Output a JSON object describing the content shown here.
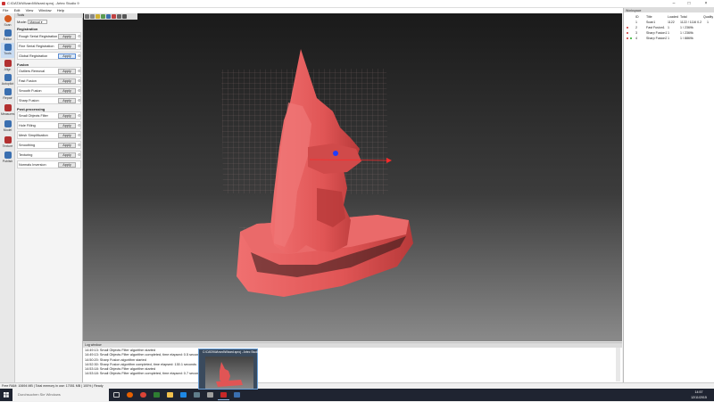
{
  "window": {
    "title": "C:\\DATA\\Wizard\\Wizard.sproj - Artec Studio 9"
  },
  "menu": [
    "File",
    "Edit",
    "View",
    "Window",
    "Help"
  ],
  "tools": [
    {
      "label": "Scan",
      "icon": "scan-icon",
      "color": "#d45a20"
    },
    {
      "label": "Editor",
      "icon": "editor-icon",
      "color": "#3a6fb0"
    },
    {
      "label": "Tools",
      "icon": "tools-icon",
      "color": "#3a6fb0"
    },
    {
      "label": "Align",
      "icon": "align-icon",
      "color": "#b23030"
    },
    {
      "label": "Autopilot",
      "icon": "autopilot-icon",
      "color": "#3a6fb0"
    },
    {
      "label": "Repair",
      "icon": "repair-icon",
      "color": "#3a6fb0"
    },
    {
      "label": "Measures",
      "icon": "measures-icon",
      "color": "#b23030"
    },
    {
      "label": "Model",
      "icon": "model-icon",
      "color": "#3a6fb0"
    },
    {
      "label": "Texture",
      "icon": "texture-icon",
      "color": "#b23030"
    },
    {
      "label": "Publish",
      "icon": "publish-icon",
      "color": "#3a6fb0"
    }
  ],
  "panel": {
    "header": "Tools",
    "mode_label": "Mode:",
    "mode_value": "Manual",
    "apply_label": "Apply",
    "sections": {
      "registration": "Registration",
      "fusion": "Fusion",
      "postprocessing": "Post-processing"
    },
    "registration": [
      "Rough Serial Registration",
      "Fine Serial Registration",
      "Global Registration"
    ],
    "fusion": [
      "Outliers Removal",
      "Fast Fusion",
      "Smooth Fusion",
      "Sharp Fusion"
    ],
    "postprocessing": [
      "Small Objects Filter",
      "Hole Filling",
      "Mesh Simplification",
      "Smoothing",
      "Texturing",
      "Normals Inversion"
    ]
  },
  "workspace": {
    "header": "Workspace",
    "columns": [
      "ID",
      "Title",
      "Loaded",
      "Total",
      "Quality"
    ],
    "rows": [
      {
        "id": "1",
        "title": "Scan1",
        "loaded": "1122",
        "total": "1122 / 1116 0.2",
        "quality": "1"
      },
      {
        "id": "2",
        "title": "Fast Fusion1",
        "loaded": "1",
        "total": "1 / 2369k",
        "quality": ""
      },
      {
        "id": "3",
        "title": "Sharp Fusion1",
        "loaded": "1",
        "total": "1 / 2369k",
        "quality": ""
      },
      {
        "id": "4",
        "title": "Sharp Fusion2",
        "loaded": "1",
        "total": "1 / 8869k",
        "quality": ""
      }
    ]
  },
  "log": {
    "header": "Log window",
    "lines": [
      "14:49:13: Small Objects Filter algorithm started",
      "14:49:13: Small Objects Filter algorithm completed, time elapsed: 0.5 seconds",
      "14:50:20: Sharp Fusion algorithm started",
      "14:52:30: Sharp Fusion algorithm completed, time elapsed: 130.1 seconds",
      "14:53:18: Small Objects Filter algorithm started",
      "14:53:18: Small Objects Filter algorithm completed, time elapsed: 0.7 seconds"
    ]
  },
  "status": "Free RAM: 10694 MB  |  Total memory in use: 17051 MB  |  100%  |  Ready",
  "taskbar": {
    "search_placeholder": "Durchsuchen Sie Windows",
    "thumbnail_title": "C:\\DATA\\Wizard\\Wizard.sproj - Artec Studio",
    "clock_time": "14:57",
    "clock_date": "12/11/2015"
  },
  "colors": {
    "model": "#e05555",
    "axis": "#ff2a2a",
    "pivot": "#1f3cff",
    "accent": "#5a8ad0"
  }
}
